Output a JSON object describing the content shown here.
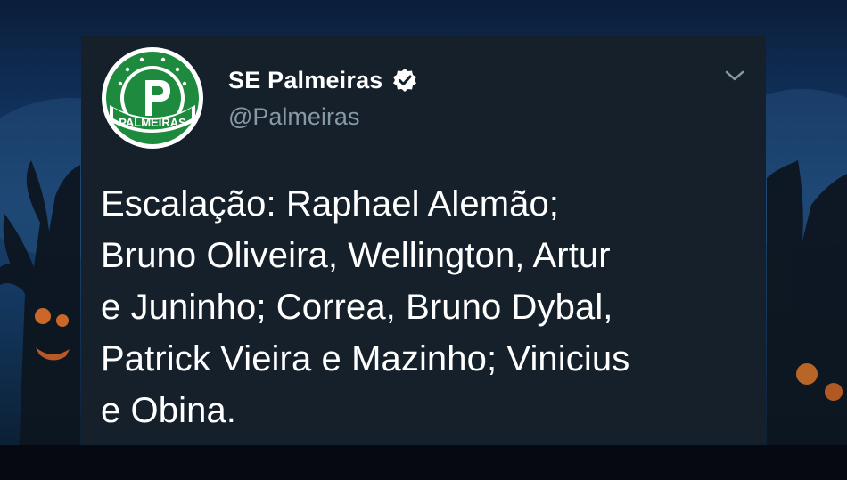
{
  "tweet": {
    "display_name": "SE Palmeiras",
    "handle": "@Palmeiras",
    "text": "Escalação: Raphael Alemão;\nBruno Oliveira, Wellington, Artur\ne Juninho; Correa, Bruno Dybal,\nPatrick Vieira e Mazinho; Vinicius\ne Obina.",
    "verified": true,
    "avatar_logo_text": "PALMEIRAS"
  },
  "icons": {
    "verified": "verified-badge-icon",
    "menu": "chevron-down-icon",
    "avatar": "palmeiras-crest"
  },
  "colors": {
    "card_background": "#15202b",
    "text_primary": "#ffffff",
    "text_secondary": "#8899a6",
    "crest_green": "#1e8a3e"
  }
}
